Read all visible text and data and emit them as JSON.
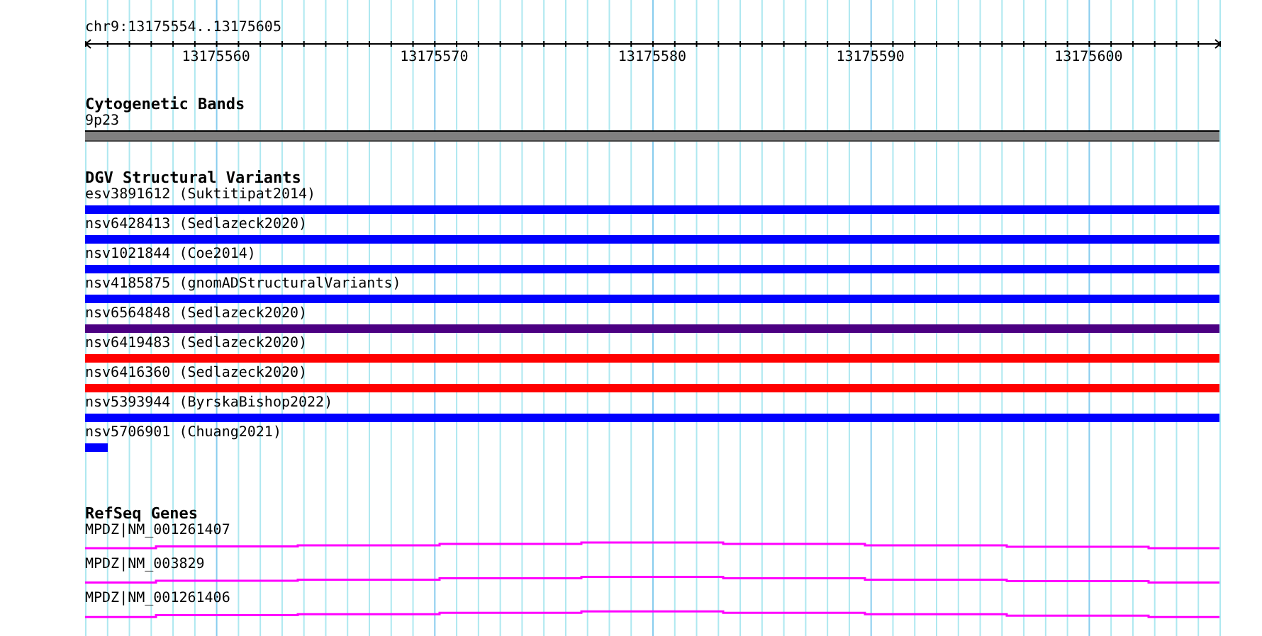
{
  "location": "chr9:13175554..13175605",
  "ruler": {
    "tick_labels": [
      "13175560",
      "13175570",
      "13175580",
      "13175590",
      "13175600"
    ]
  },
  "cytogenetic_bands": {
    "title": "Cytogenetic Bands",
    "band": "9p23"
  },
  "dgv_structural_variants": {
    "title": "DGV Structural Variants",
    "variants": [
      {
        "label": "esv3891612 (Suktitipat2014)",
        "color": "#0000ff",
        "kind": "span"
      },
      {
        "label": "nsv6428413 (Sedlazeck2020)",
        "color": "#0000ff",
        "kind": "span"
      },
      {
        "label": "nsv1021844 (Coe2014)",
        "color": "#0000ff",
        "kind": "span"
      },
      {
        "label": "nsv4185875 (gnomADStructuralVariants)",
        "color": "#0000ff",
        "kind": "span"
      },
      {
        "label": "nsv6564848 (Sedlazeck2020)",
        "color": "#4b0082",
        "kind": "span"
      },
      {
        "label": "nsv6419483 (Sedlazeck2020)",
        "color": "#ff0000",
        "kind": "span"
      },
      {
        "label": "nsv6416360 (Sedlazeck2020)",
        "color": "#ff0000",
        "kind": "span"
      },
      {
        "label": "nsv5393944 (ByrskaBishop2022)",
        "color": "#0000ff",
        "kind": "span"
      },
      {
        "label": "nsv5706901 (Chuang2021)",
        "color": "#0000ff",
        "kind": "stub"
      }
    ]
  },
  "refseq_genes": {
    "title": "RefSeq Genes",
    "transcripts": [
      {
        "label": "MPDZ|NM_001261407"
      },
      {
        "label": "MPDZ|NM_003829"
      },
      {
        "label": "MPDZ|NM_001261406"
      }
    ]
  }
}
